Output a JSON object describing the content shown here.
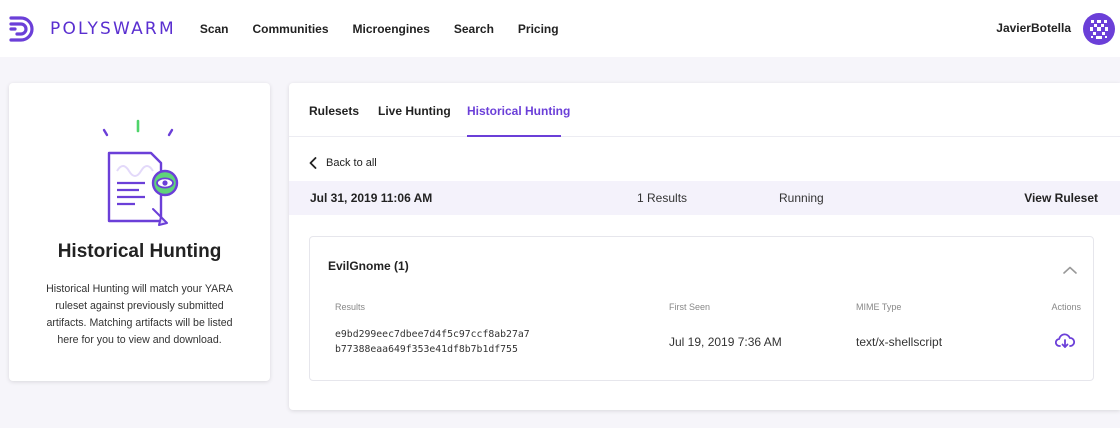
{
  "header": {
    "brand": "POLYSWARM",
    "nav": [
      "Scan",
      "Communities",
      "Microengines",
      "Search",
      "Pricing"
    ],
    "user": "JavierBotella",
    "accent": "#6b3fd8"
  },
  "info_card": {
    "title": "Historical Hunting",
    "description": "Historical Hunting will match your YARA ruleset against previously submitted artifacts. Matching artifacts will be listed here for you to view and download.",
    "icon": "document-eye-icon"
  },
  "tabs": [
    {
      "label": "Rulesets",
      "active": false
    },
    {
      "label": "Live Hunting",
      "active": false
    },
    {
      "label": "Historical Hunting",
      "active": true
    }
  ],
  "back_label": "Back to all",
  "run": {
    "date": "Jul 31, 2019 11:06 AM",
    "results": "1 Results",
    "status": "Running",
    "view_label": "View Ruleset"
  },
  "rule": {
    "title": "EvilGnome (1)",
    "columns": {
      "results": "Results",
      "first_seen": "First Seen",
      "mime": "MIME Type",
      "actions": "Actions"
    },
    "rows": [
      {
        "hash_line1": "e9bd299eec7dbee7d4f5c97ccf8ab27a7",
        "hash_line2": "b77388eaa649f353e41df8b7b1df755",
        "first_seen": "Jul 19, 2019 7:36 AM",
        "mime": "text/x-shellscript",
        "action_icon": "cloud-download-icon"
      }
    ]
  }
}
